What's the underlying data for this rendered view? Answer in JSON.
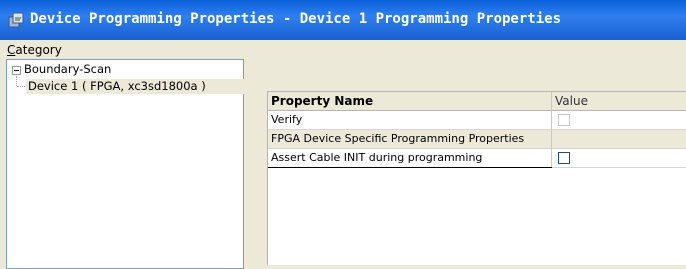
{
  "window": {
    "title": "Device Programming Properties - Device 1 Programming Properties"
  },
  "category": {
    "label_accel": "C",
    "label_rest": "ategory"
  },
  "tree": {
    "items": [
      {
        "label": "Boundary-Scan",
        "expanded": true
      },
      {
        "label": "Device 1 ( FPGA, xc3sd1800a )",
        "selected": true
      }
    ]
  },
  "grid": {
    "columns": {
      "name": "Property Name",
      "value": "Value"
    },
    "rows": [
      {
        "name": "Verify",
        "value_checked": false,
        "enabled": false
      },
      {
        "name": "FPGA Device Specific Programming Properties",
        "category": true
      },
      {
        "name": "Assert Cable INIT during programming",
        "value_checked": false,
        "enabled": true
      }
    ]
  },
  "colors": {
    "titlebar": "#0a5fd8",
    "window_bg": "#ece9d8"
  }
}
